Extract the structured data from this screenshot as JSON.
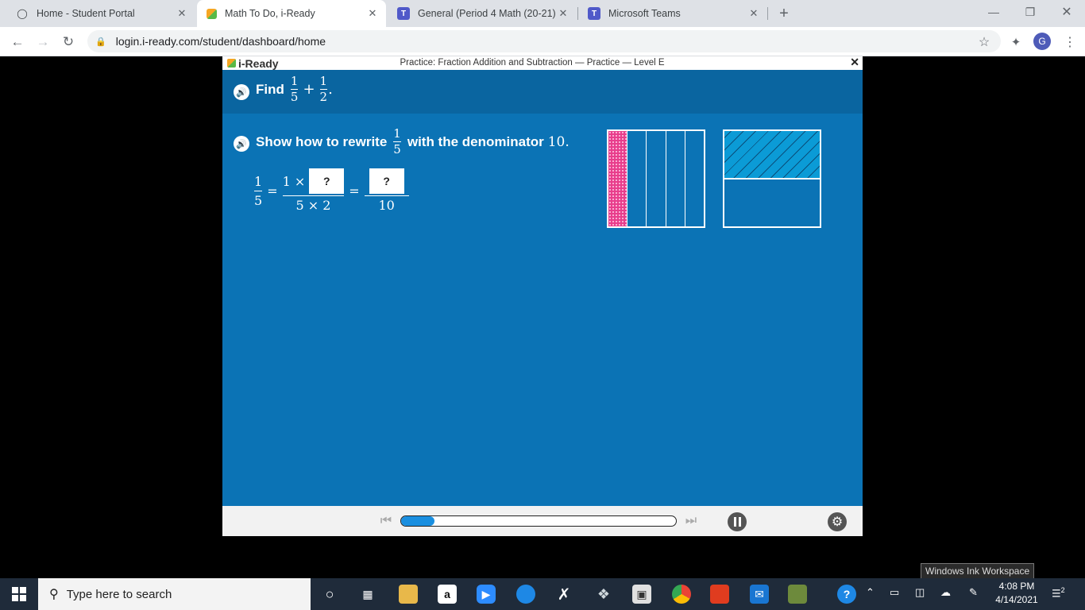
{
  "browser": {
    "tabs": [
      {
        "title": "Home - Student Portal",
        "active": false
      },
      {
        "title": "Math To Do, i-Ready",
        "active": true
      },
      {
        "title": "General (Period 4 Math (20-21)) |",
        "active": false
      },
      {
        "title": "Microsoft Teams",
        "active": false
      }
    ],
    "url": "login.i-ready.com/student/dashboard/home",
    "profile_initial": "G"
  },
  "app": {
    "logo": "i-Ready",
    "lesson_title": "Practice: Fraction Addition and Subtraction — Practice — Level E",
    "close": "✕",
    "prompt": {
      "find_label": "Find",
      "frac_a_num": "1",
      "frac_a_den": "5",
      "plus": "+",
      "frac_b_num": "1",
      "frac_b_den": "2",
      "end": "."
    },
    "question": {
      "text_before": "Show how to rewrite",
      "frac_num": "1",
      "frac_den": "5",
      "text_after": "with the denominator",
      "denominator": "10."
    },
    "equation": {
      "lhs_num": "1",
      "lhs_den": "5",
      "equals": "=",
      "mid_num_prefix": "1 ×",
      "mid_den": "5 × 2",
      "box_a": "?",
      "box_b": "?",
      "rhs_den": "10"
    },
    "model_colors": {
      "fifths_fill": "#e83e8c",
      "half_fill": "#0b9bd6"
    },
    "player": {
      "progress": 0.12
    }
  },
  "tooltip": "Windows Ink Workspace",
  "taskbar": {
    "search_placeholder": "Type here to search",
    "time": "4:08 PM",
    "date": "4/14/2021",
    "notifications": "2"
  }
}
